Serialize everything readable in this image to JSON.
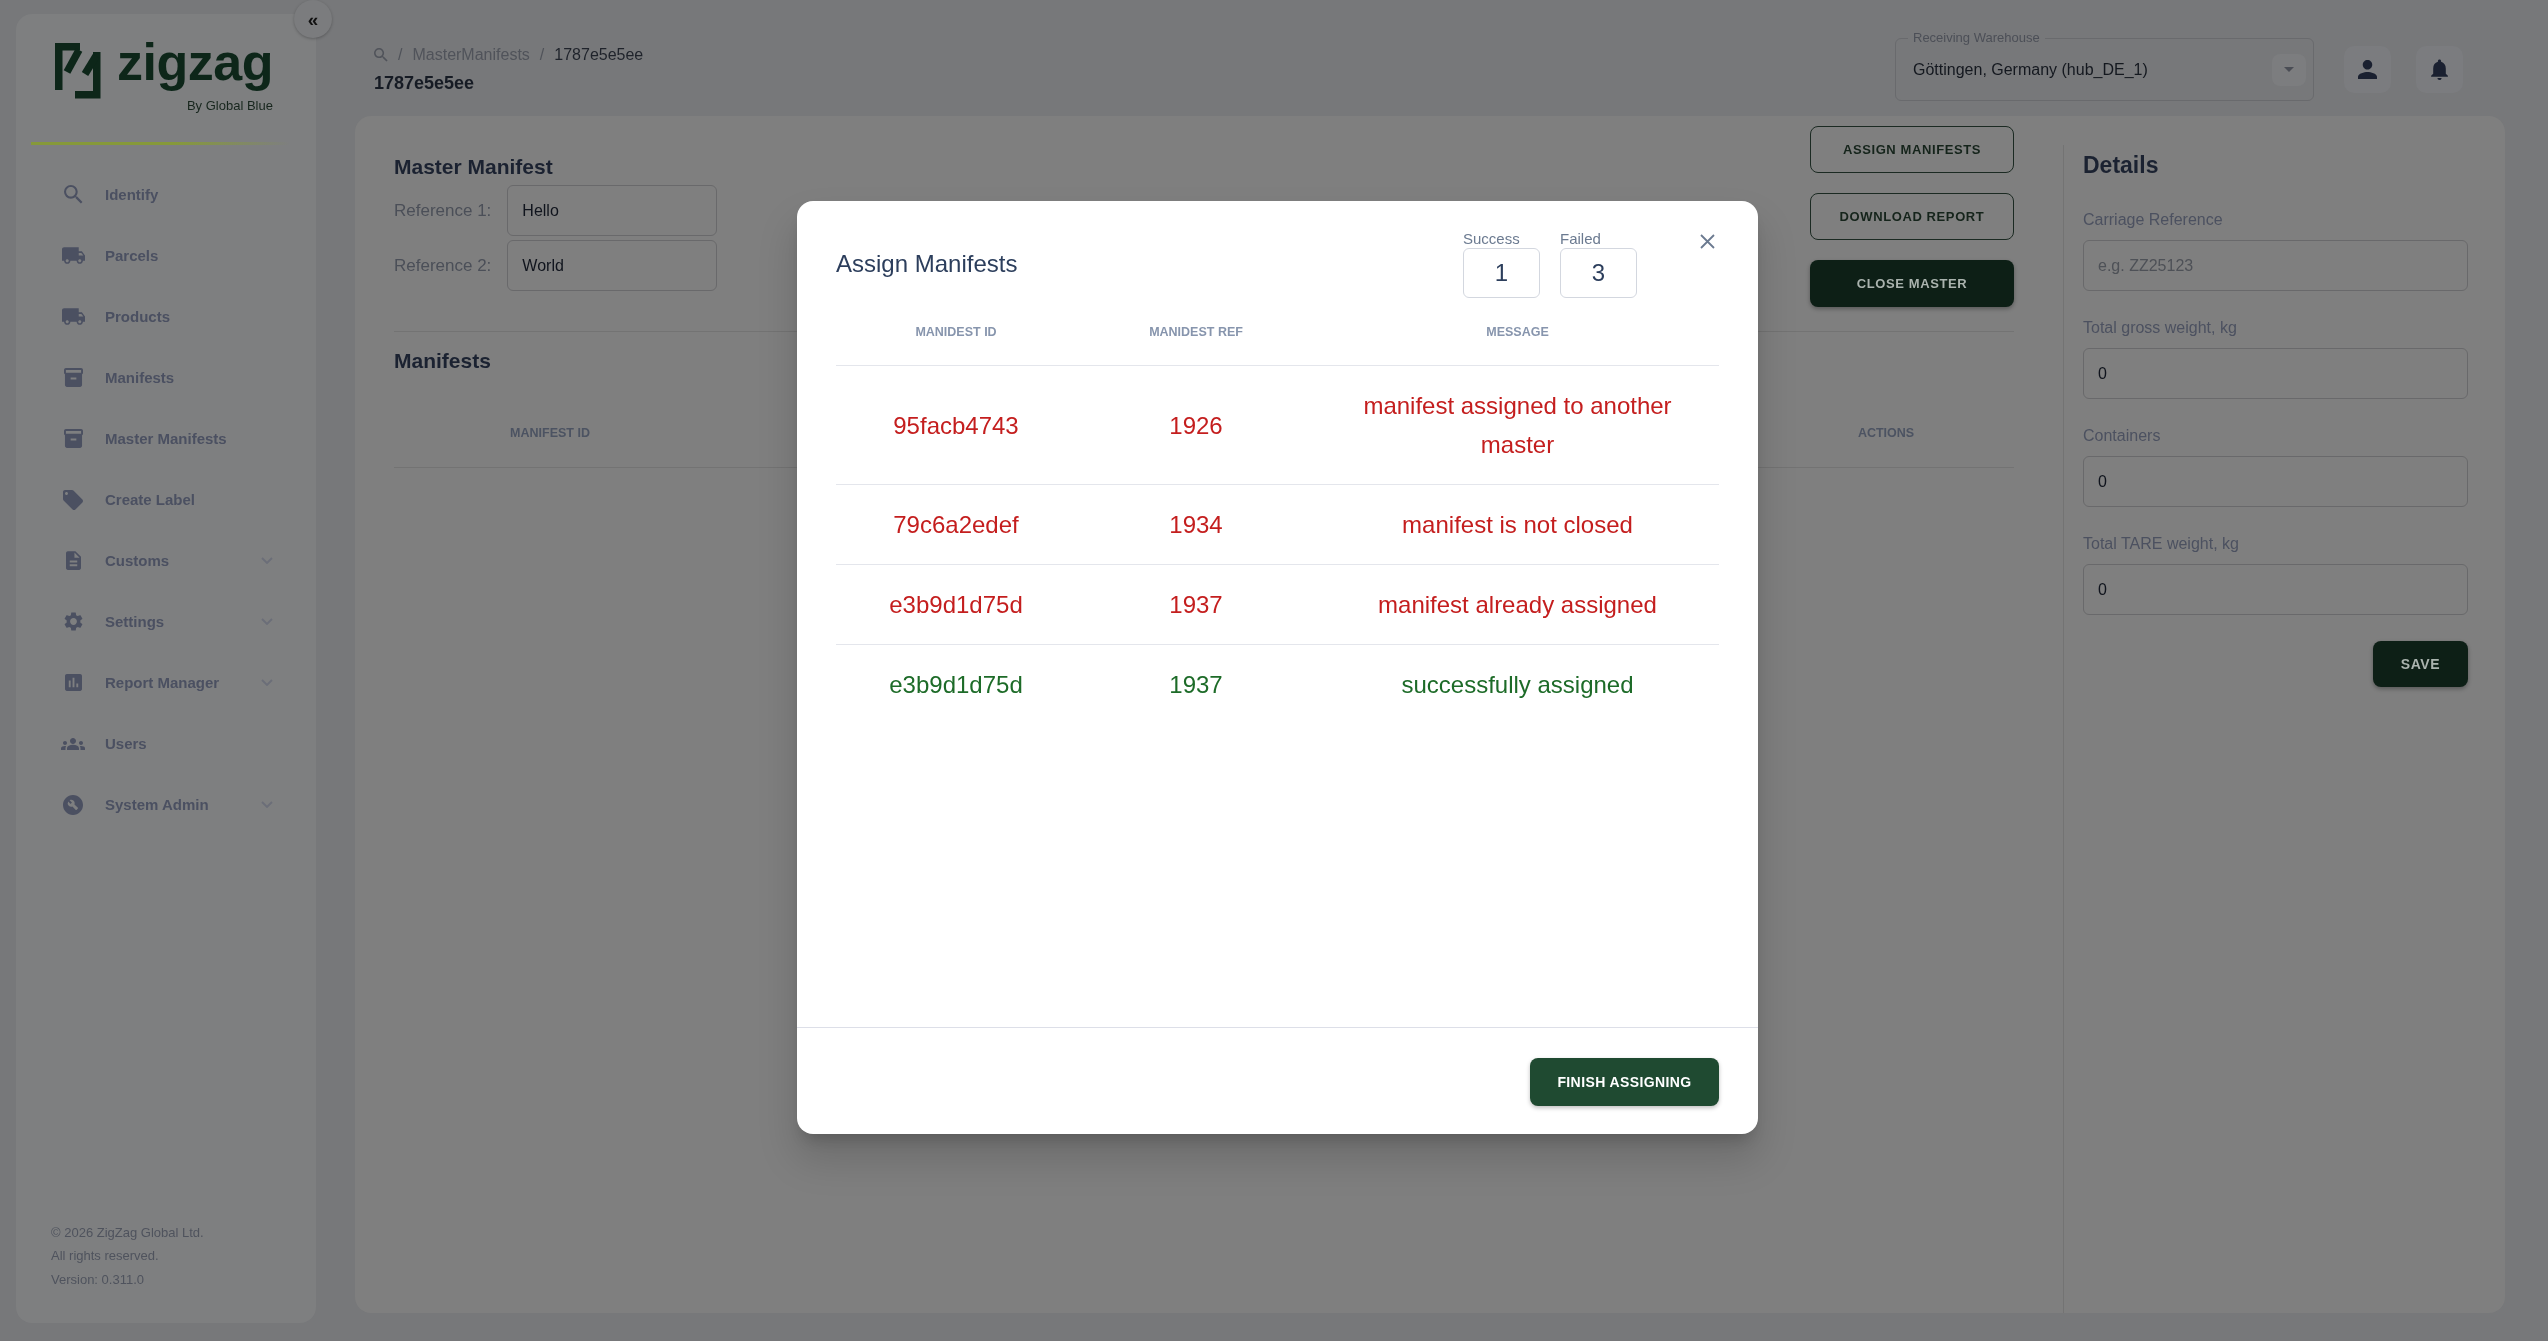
{
  "sidebar": {
    "collapse_button": "«",
    "logo": {
      "wordmark": "zigzag",
      "tagline": "By Global Blue"
    },
    "items": [
      {
        "label": "Identify",
        "expandable": false
      },
      {
        "label": "Parcels",
        "expandable": false
      },
      {
        "label": "Products",
        "expandable": false
      },
      {
        "label": "Manifests",
        "expandable": false
      },
      {
        "label": "Master Manifests",
        "expandable": false
      },
      {
        "label": "Create Label",
        "expandable": false
      },
      {
        "label": "Customs",
        "expandable": true
      },
      {
        "label": "Settings",
        "expandable": true
      },
      {
        "label": "Report Manager",
        "expandable": true
      },
      {
        "label": "Users",
        "expandable": false
      },
      {
        "label": "System Admin",
        "expandable": true
      }
    ],
    "footer": [
      "© 2026 ZigZag Global Ltd.",
      "All rights reserved.",
      "Version: 0.311.0"
    ]
  },
  "header": {
    "breadcrumb": {
      "separator": "/",
      "items": [
        {
          "label": "MasterManifests",
          "current": false
        },
        {
          "label": "1787e5e5ee",
          "current": true
        }
      ]
    },
    "page_title": "1787e5e5ee",
    "warehouse_select": {
      "label": "Receiving Warehouse",
      "value": "Göttingen, Germany (hub_DE_1)"
    }
  },
  "master_manifest": {
    "title": "Master Manifest",
    "references": [
      {
        "label": "Reference 1:",
        "value": "Hello"
      },
      {
        "label": "Reference 2:",
        "value": "World"
      }
    ]
  },
  "actions": [
    {
      "label": "ASSIGN MANIFESTS",
      "kind": "outlined"
    },
    {
      "label": "DOWNLOAD REPORT",
      "kind": "outlined"
    },
    {
      "label": "CLOSE MASTER",
      "kind": "filled"
    }
  ],
  "manifests": {
    "title": "Manifests",
    "columns": [
      "MANIFEST ID",
      "ACTIONS"
    ]
  },
  "details": {
    "title": "Details",
    "fields": [
      {
        "label": "Carriage Reference",
        "placeholder": "e.g. ZZ25123"
      },
      {
        "label": "Total gross weight, kg",
        "value": "0"
      },
      {
        "label": "Containers",
        "value": "0"
      },
      {
        "label": "Total TARE weight, kg",
        "value": "0"
      }
    ],
    "save_button": "SAVE"
  },
  "dialog": {
    "title": "Assign Manifests",
    "counters": [
      {
        "label": "Success",
        "value": "1"
      },
      {
        "label": "Failed",
        "value": "3"
      }
    ],
    "columns": [
      "MANIDEST ID",
      "MANIDEST REF",
      "MESSAGE"
    ],
    "rows": [
      {
        "manifest_id": "95facb4743",
        "manifest_ref": "1926",
        "message": "manifest assigned to another master",
        "color": "#c41e1e"
      },
      {
        "manifest_id": "79c6a2edef",
        "manifest_ref": "1934",
        "message": "manifest is not closed",
        "color": "#c41e1e"
      },
      {
        "manifest_id": "e3b9d1d75d",
        "manifest_ref": "1937",
        "message": "manifest already assigned",
        "color": "#c41e1e"
      },
      {
        "manifest_id": "e3b9d1d75d",
        "manifest_ref": "1937",
        "message": "successfully assigned",
        "color": "#1d6b28"
      }
    ],
    "finish_button": "FINISH ASSIGNING"
  }
}
